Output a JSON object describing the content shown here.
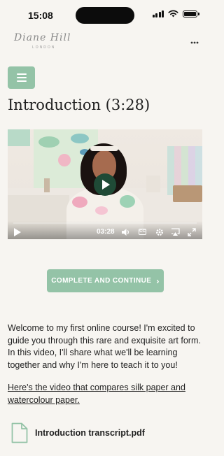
{
  "status_bar": {
    "time": "15:08"
  },
  "header": {
    "logo_text": "Diane Hill",
    "logo_sub": "LONDON",
    "more_label": "..."
  },
  "lesson": {
    "title": "Introduction (3:28)",
    "video": {
      "current_time": "03:28",
      "cc_label": "CC"
    },
    "complete_button": "COMPLETE AND CONTINUE",
    "complete_chevron": "›",
    "body": "Welcome to my first online course! I'm excited to guide you through this rare and exquisite art form. In this video, I'll share what we'll be learning together and why I'm here to teach it to you!",
    "link": "Here's the video that compares silk paper and watercolour paper.",
    "attachment": "Introduction transcript.pdf"
  },
  "colors": {
    "accent": "#94c3a7",
    "play_button": "#1f4a36",
    "background": "#f7f5f1"
  }
}
